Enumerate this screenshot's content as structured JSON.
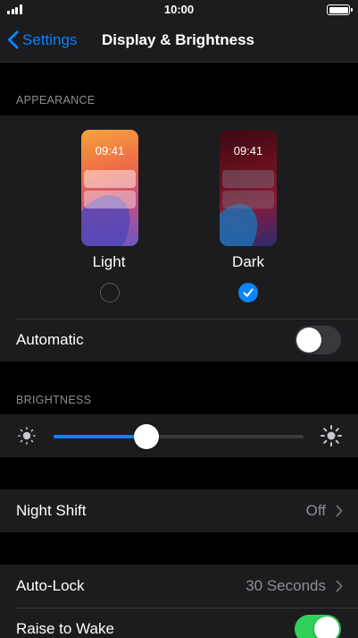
{
  "status_bar": {
    "time": "10:00"
  },
  "nav": {
    "back_label": "Settings",
    "title": "Display & Brightness"
  },
  "appearance": {
    "header": "APPEARANCE",
    "options": [
      {
        "label": "Light",
        "preview_time": "09:41",
        "selected": false
      },
      {
        "label": "Dark",
        "preview_time": "09:41",
        "selected": true
      }
    ],
    "automatic": {
      "label": "Automatic",
      "on": false
    }
  },
  "brightness": {
    "header": "BRIGHTNESS",
    "level": 0.37
  },
  "night_shift": {
    "label": "Night Shift",
    "value": "Off"
  },
  "auto_lock": {
    "label": "Auto-Lock",
    "value": "30 Seconds"
  },
  "raise_to_wake": {
    "label": "Raise to Wake",
    "on": true
  },
  "colors": {
    "accent": "#0a84ff",
    "switch_on": "#30d158",
    "switch_off": "#39393d",
    "cell_bg": "#1c1c1e",
    "page_bg": "#000000",
    "secondary_text": "#8e8e93"
  }
}
